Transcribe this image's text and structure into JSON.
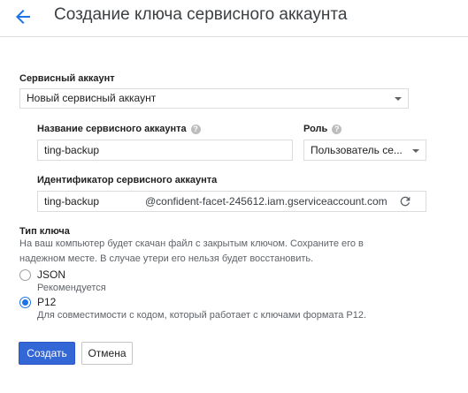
{
  "header": {
    "title": "Создание ключа сервисного аккаунта"
  },
  "service_account": {
    "label": "Сервисный аккаунт",
    "selected": "Новый сервисный аккаунт"
  },
  "account_name": {
    "label": "Название сервисного аккаунта",
    "value": "ting-backup"
  },
  "role": {
    "label": "Роль",
    "selected": "Пользователь се..."
  },
  "account_id": {
    "label": "Идентификатор сервисного аккаунта",
    "value": "ting-backup",
    "domain": "@confident-facet-245612.iam.gserviceaccount.com"
  },
  "key_type": {
    "title": "Тип ключа",
    "description": "На ваш компьютер будет скачан файл с закрытым ключом. Сохраните его в надежном месте. В случае утери его нельзя будет восстановить.",
    "options": [
      {
        "label": "JSON",
        "sub": "Рекомендуется",
        "checked": false
      },
      {
        "label": "P12",
        "sub": "Для совместимости с кодом, который работает с ключами формата P12.",
        "checked": true
      }
    ]
  },
  "actions": {
    "create": "Создать",
    "cancel": "Отмена"
  },
  "colors": {
    "accent": "#1a73e8",
    "primary_button": "#3367d6"
  }
}
